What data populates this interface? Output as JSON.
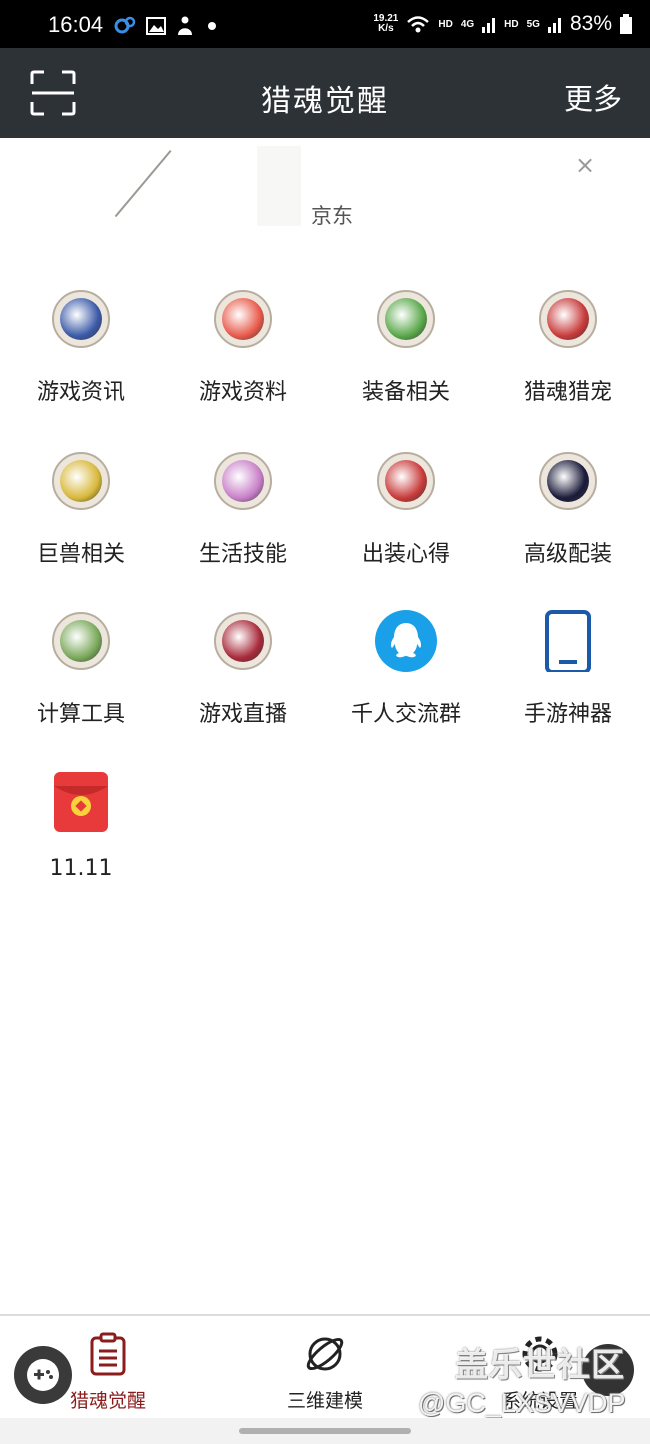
{
  "status_bar": {
    "time": "16:04",
    "net_speed_value": "19.21",
    "net_speed_unit": "K/s",
    "hd1": "HD",
    "net1": "4G",
    "hd2": "HD",
    "net2": "5G",
    "battery": "83%",
    "icons": [
      "settings-cog-icon",
      "image-icon",
      "person-icon",
      "dot-icon",
      "wifi-icon",
      "signal-icon",
      "battery-icon"
    ]
  },
  "header": {
    "title": "猎魂觉醒",
    "more_label": "更多",
    "scan_icon": "scan-icon"
  },
  "ad": {
    "label": "京东",
    "close_label": "×"
  },
  "grid": [
    {
      "label": "游戏资讯",
      "icon": "game-news-icon",
      "color": "#3b5aa8"
    },
    {
      "label": "游戏资料",
      "icon": "game-data-icon",
      "color": "#e85a4a"
    },
    {
      "label": "装备相关",
      "icon": "equipment-icon",
      "color": "#5aa84a"
    },
    {
      "label": "猎魂猎宠",
      "icon": "pet-icon",
      "color": "#c83a3a"
    },
    {
      "label": "巨兽相关",
      "icon": "beast-icon",
      "color": "#d8b83a"
    },
    {
      "label": "生活技能",
      "icon": "life-skill-icon",
      "color": "#c880c8"
    },
    {
      "label": "出装心得",
      "icon": "build-guide-icon",
      "color": "#c83a3a"
    },
    {
      "label": "高级配装",
      "icon": "advanced-build-icon",
      "color": "#1a1a3a"
    },
    {
      "label": "计算工具",
      "icon": "calculator-icon",
      "color": "#7aa85a"
    },
    {
      "label": "游戏直播",
      "icon": "live-stream-icon",
      "color": "#a82a3a"
    },
    {
      "label": "千人交流群",
      "icon": "qq-group-icon",
      "color": "#1aa0e8"
    },
    {
      "label": "手游神器",
      "icon": "phone-icon",
      "color": "#1a5aa8"
    },
    {
      "label": "11.11",
      "icon": "red-envelope-icon",
      "color": "#e83a3a"
    }
  ],
  "nav": {
    "items": [
      {
        "label": "猎魂觉醒",
        "icon": "clipboard-icon"
      },
      {
        "label": "三维建模",
        "icon": "planet-icon"
      },
      {
        "label": "系统设置",
        "icon": "gear-icon"
      }
    ],
    "active_color": "#8a1c1c"
  },
  "watermark": {
    "main": "盖乐世社区",
    "sub": "@GC_LXSVVDP"
  }
}
